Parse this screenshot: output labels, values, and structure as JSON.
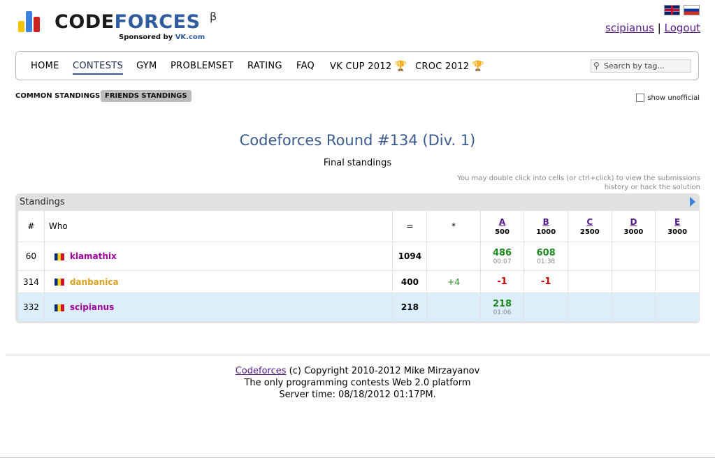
{
  "header": {
    "logo_code": "CODE",
    "logo_forces": "FORCES",
    "logo_beta": "β",
    "sponsor_prefix": "Sponsored by",
    "sponsor_name": "VK.com",
    "bar_colors": [
      "#f5c400",
      "#3b82e0",
      "#cc2222"
    ],
    "user": "scipianus",
    "separator": "|",
    "logout": "Logout"
  },
  "menu": {
    "items": [
      "HOME",
      "CONTESTS",
      "GYM",
      "PROBLEMSET",
      "RATING",
      "FAQ",
      "VK CUP 2012",
      "CROC 2012"
    ],
    "trophy_icon": "trophy-icon",
    "search_placeholder": "Search by tag..."
  },
  "tabs": {
    "common": "COMMON STANDINGS",
    "friends": "FRIENDS STANDINGS",
    "show_unofficial": "show unofficial"
  },
  "contest": {
    "title": "Codeforces Round #134 (Div. 1)",
    "subtitle": "Final standings",
    "hint": "You may double click into cells (or ctrl+click) to view the submissions history or hack the solution"
  },
  "standings": {
    "title": "Standings",
    "columns": {
      "rank": "#",
      "who": "Who",
      "points": "=",
      "hacks": "*"
    },
    "problems": [
      {
        "letter": "A",
        "points": "500"
      },
      {
        "letter": "B",
        "points": "1000"
      },
      {
        "letter": "C",
        "points": "2500"
      },
      {
        "letter": "D",
        "points": "3000"
      },
      {
        "letter": "E",
        "points": "3000"
      }
    ],
    "rows": [
      {
        "rank": "60",
        "handle": "klamathix",
        "handle_color": "#a000a0",
        "points": "1094",
        "hacks": "",
        "a": "486",
        "a_time": "00:07",
        "b": "608",
        "b_time": "01:38"
      },
      {
        "rank": "314",
        "handle": "danbanica",
        "handle_color": "#e0a020",
        "points": "400",
        "hacks": "+4",
        "a": "-1",
        "b": "-1"
      },
      {
        "rank": "332",
        "handle": "scipianus",
        "handle_color": "#a000a0",
        "points": "218",
        "hacks": "",
        "a": "218",
        "a_time": "01:06"
      }
    ]
  },
  "footer": {
    "link": "Codeforces",
    "copyright": "(c) Copyright 2010-2012 Mike Mirzayanov",
    "line2": "The only programming contests Web 2.0 platform",
    "line3": "Server time: 08/18/2012 01:17PM."
  }
}
